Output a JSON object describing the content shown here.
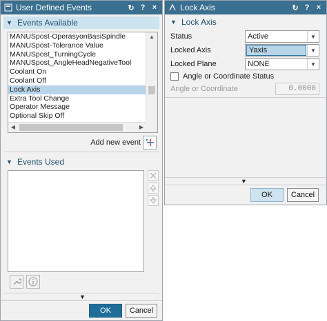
{
  "left_dialog": {
    "title": "User Defined Events",
    "title_buttons": [
      "↻",
      "?",
      "×"
    ],
    "events_available": {
      "header": "Events Available",
      "items": [
        "MANUSpost-OperasyonBasiSpindle",
        "MANUSpost-Tolerance Value",
        "MANUSpost_TurningCycle",
        "MANUSpost_AngleHeadNegativeTool",
        "Coolant On",
        "Coolant Off",
        "Lock Axis",
        "Extra Tool Change",
        "Operator Message",
        "Optional Skip Off"
      ],
      "selected_index": 6,
      "add_new_event_label": "Add new event"
    },
    "events_used": {
      "header": "Events Used"
    },
    "ok_label": "OK",
    "cancel_label": "Cancel"
  },
  "right_dialog": {
    "title": "Lock Axis",
    "title_buttons": [
      "↻",
      "?",
      "×"
    ],
    "section_header": "Lock Axis",
    "fields": {
      "status_label": "Status",
      "status_value": "Active",
      "locked_axis_label": "Locked Axis",
      "locked_axis_value": "Yaxis",
      "locked_plane_label": "Locked Plane",
      "locked_plane_value": "NONE",
      "angle_checkbox_label": "Angle or Coordinate Status",
      "angle_field_label": "Angle or Coordinate",
      "angle_field_value": "0.0000"
    },
    "ok_label": "OK",
    "cancel_label": "Cancel"
  },
  "colors": {
    "titlebar": "#3a6f8f",
    "section_header_bg": "#cde3ef",
    "selection": "#b7d4e8",
    "primary_button": "#1f6e99"
  }
}
